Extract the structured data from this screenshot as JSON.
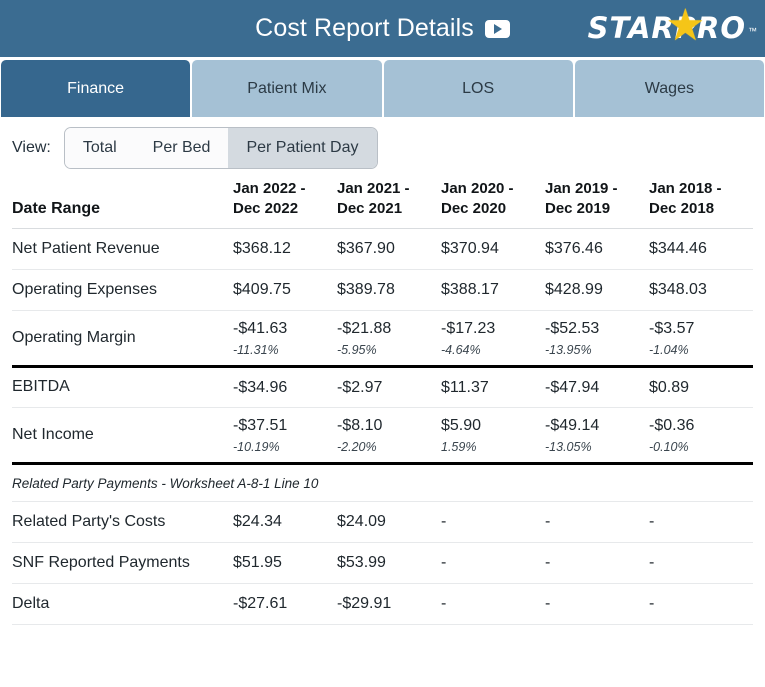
{
  "header": {
    "title": "Cost Report Details",
    "play_icon": "play-icon",
    "logo_text": "STARPRO",
    "logo_star": "★",
    "logo_tm": "™",
    "bg_color": "#3b6c91"
  },
  "tabs": [
    {
      "label": "Finance",
      "active": true
    },
    {
      "label": "Patient Mix",
      "active": false
    },
    {
      "label": "LOS",
      "active": false
    },
    {
      "label": "Wages",
      "active": false
    }
  ],
  "view": {
    "label": "View:",
    "options": [
      {
        "label": "Total",
        "selected": false
      },
      {
        "label": "Per Bed",
        "selected": false
      },
      {
        "label": "Per Patient Day",
        "selected": true
      }
    ]
  },
  "table": {
    "row_header_label": "Date Range",
    "columns": [
      {
        "line1": "Jan 2022 -",
        "line2": "Dec 2022"
      },
      {
        "line1": "Jan 2021 -",
        "line2": "Dec 2021"
      },
      {
        "line1": "Jan 2020 -",
        "line2": "Dec 2020"
      },
      {
        "line1": "Jan 2019 -",
        "line2": "Dec 2019"
      },
      {
        "line1": "Jan 2018 -",
        "line2": "Dec 2018"
      }
    ],
    "rows": [
      {
        "label": "Net Patient Revenue",
        "values": [
          "$368.12",
          "$367.90",
          "$370.94",
          "$376.46",
          "$344.46"
        ],
        "subvalues": null,
        "heavy_bottom": false
      },
      {
        "label": "Operating Expenses",
        "values": [
          "$409.75",
          "$389.78",
          "$388.17",
          "$428.99",
          "$348.03"
        ],
        "subvalues": null,
        "heavy_bottom": false
      },
      {
        "label": "Operating Margin",
        "values": [
          "-$41.63",
          "-$21.88",
          "-$17.23",
          "-$52.53",
          "-$3.57"
        ],
        "subvalues": [
          "-11.31%",
          "-5.95%",
          "-4.64%",
          "-13.95%",
          "-1.04%"
        ],
        "heavy_bottom": true
      },
      {
        "label": "EBITDA",
        "values": [
          "-$34.96",
          "-$2.97",
          "$11.37",
          "-$47.94",
          "$0.89"
        ],
        "subvalues": null,
        "heavy_bottom": false
      },
      {
        "label": "Net Income",
        "values": [
          "-$37.51",
          "-$8.10",
          "$5.90",
          "-$49.14",
          "-$0.36"
        ],
        "subvalues": [
          "-10.19%",
          "-2.20%",
          "1.59%",
          "-13.05%",
          "-0.10%"
        ],
        "heavy_bottom": true
      }
    ],
    "section": {
      "title": "Related Party Payments - Worksheet A-8-1 Line 10",
      "rows": [
        {
          "label": "Related Party's Costs",
          "values": [
            "$24.34",
            "$24.09",
            "-",
            "-",
            "-"
          ],
          "subvalues": null,
          "heavy_bottom": false
        },
        {
          "label": "SNF Reported Payments",
          "values": [
            "$51.95",
            "$53.99",
            "-",
            "-",
            "-"
          ],
          "subvalues": null,
          "heavy_bottom": false
        },
        {
          "label": "Delta",
          "values": [
            "-$27.61",
            "-$29.91",
            "-",
            "-",
            "-"
          ],
          "subvalues": null,
          "heavy_bottom": false
        }
      ]
    }
  }
}
